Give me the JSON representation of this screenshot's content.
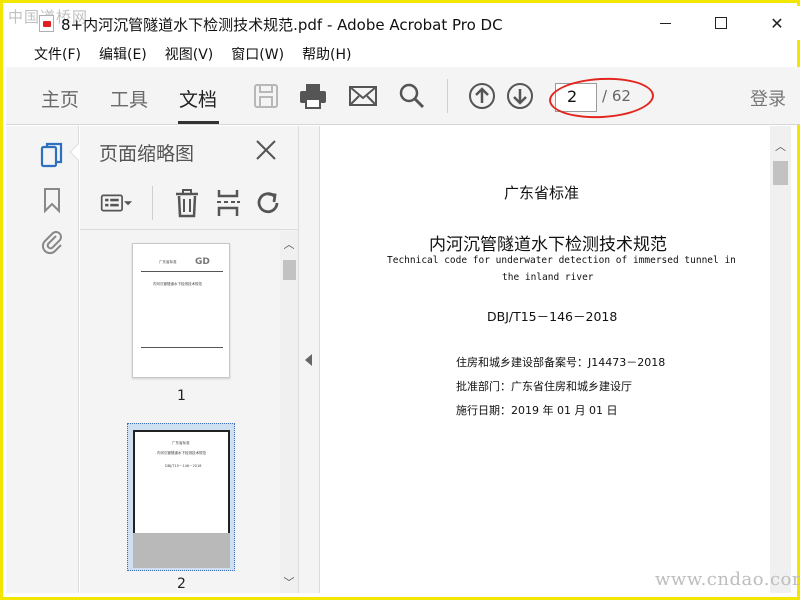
{
  "window": {
    "title": "8+内河沉管隧道水下检测技术规范.pdf - Adobe Acrobat Pro DC",
    "watermark_top": "中国道桥网",
    "watermark_bottom": "www.cndao.com",
    "close_glyph": "✕"
  },
  "menu": [
    "文件(F)",
    "编辑(E)",
    "视图(V)",
    "窗口(W)",
    "帮助(H)"
  ],
  "toolbar": {
    "tabs": [
      "主页",
      "工具",
      "文档"
    ],
    "active_tab": "文档",
    "page_current": "2",
    "page_total": "/ 62",
    "login": "登录",
    "accent_color": "#e2261e"
  },
  "sidebar": {
    "panel_title": "页面缩略图",
    "thumbnails": [
      {
        "label": "1",
        "lines": [
          "广东省标准",
          "内河沉管隧道水下检测技术规范"
        ]
      },
      {
        "label": "2",
        "lines": [
          "广东省标准",
          "内河沉管隧道水下检测技术规范",
          "DBJ/T15－146－2018"
        ]
      }
    ]
  },
  "document": {
    "standard_type": "广东省标准",
    "title": "内河沉管隧道水下检测技术规范",
    "english_line1": "Technical code for underwater detection of immersed tunnel in",
    "english_line2": "the inland river",
    "code": "DBJ/T15－146－2018",
    "registration": "住房和城乡建设部备案号：J14473－2018",
    "approval": "批准部门：广东省住房和城乡建设厅",
    "effective_date": "施行日期：2019 年 01 月 01 日"
  }
}
